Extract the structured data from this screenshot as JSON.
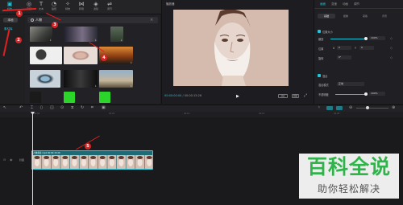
{
  "toolbar": {
    "items": [
      {
        "label": "媒体",
        "icon": "media-icon"
      },
      {
        "label": "音频",
        "icon": "audio-icon"
      },
      {
        "label": "文本",
        "icon": "text-icon"
      },
      {
        "label": "贴纸",
        "icon": "sticker-icon"
      },
      {
        "label": "特效",
        "icon": "effects-icon"
      },
      {
        "label": "转场",
        "icon": "transition-icon"
      },
      {
        "label": "滤镜",
        "icon": "filter-icon"
      },
      {
        "label": "调节",
        "icon": "adjust-icon"
      }
    ],
    "active_index": 0
  },
  "sidebar": {
    "main_label": "本地",
    "items": [
      "素材库"
    ]
  },
  "search": {
    "value": "人物"
  },
  "player": {
    "title": "播放器",
    "timecode_current": "00:00:00:00",
    "timecode_total": " / 00:00:15:26",
    "btn_fit": "适应",
    "btn_ratio": "原始"
  },
  "panel": {
    "tabs": [
      "画面",
      "变速",
      "动画",
      "调节"
    ],
    "active_tab": 0,
    "subtabs": [
      "基础",
      "抠像",
      "蒙版",
      "背景"
    ],
    "active_subtab": 0,
    "section_position": "位置大小",
    "scale_label": "缩放",
    "scale_value": "100%",
    "pos_label": "位置",
    "pos_x_label": "X",
    "pos_x": "0",
    "pos_y_label": "Y",
    "pos_y": "0",
    "rotate_label": "旋转",
    "rotate_value": "0°",
    "section_blend": "混合",
    "blend_mode_label": "混合模式",
    "blend_mode_value": "正常",
    "opacity_label": "不透明度",
    "opacity_value": "100%",
    "scale_level": 1.0,
    "opacity_level": 1.0
  },
  "timeline": {
    "ruler": [
      "00:00",
      "00:05",
      "00:10",
      "00:15",
      "00:20"
    ],
    "track_label": "封面",
    "clip_label": "人物素材.mp4  00:00:15:26"
  },
  "annotations": [
    "1",
    "2",
    "3",
    "4",
    "5"
  ],
  "watermark": {
    "title": "百科全说",
    "subtitle": "助你轻松解决"
  },
  "colors": {
    "accent": "#21c4d8",
    "annotation": "#d32626",
    "watermark_green": "#2fb44a"
  }
}
